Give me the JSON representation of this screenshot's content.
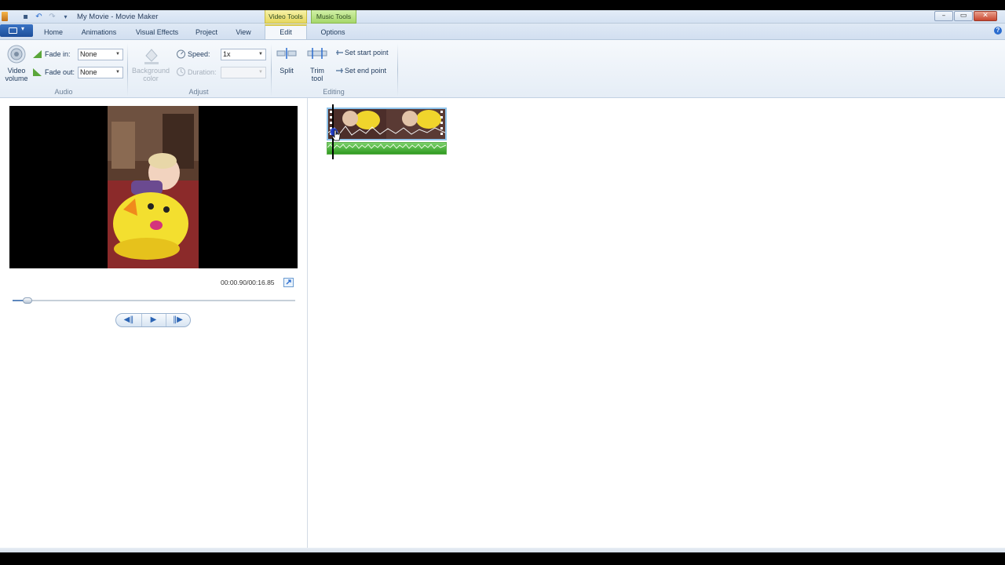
{
  "window": {
    "title": "My Movie - Movie Maker",
    "context_groups": {
      "video_tools": "Video Tools",
      "music_tools": "Music Tools"
    },
    "controls": {
      "minimize": "–",
      "maximize": "▭",
      "close": "✕"
    }
  },
  "tabs": [
    {
      "label": "Home"
    },
    {
      "label": "Animations"
    },
    {
      "label": "Visual Effects"
    },
    {
      "label": "Project"
    },
    {
      "label": "View"
    },
    {
      "label": "Edit"
    },
    {
      "label": "Options"
    }
  ],
  "ribbon": {
    "audio": {
      "group_label": "Audio",
      "video_volume": "Video volume",
      "fade_in_label": "Fade in:",
      "fade_in_value": "None",
      "fade_out_label": "Fade out:",
      "fade_out_value": "None"
    },
    "adjust": {
      "group_label": "Adjust",
      "background_color": "Background color",
      "speed_label": "Speed:",
      "speed_value": "1x",
      "duration_label": "Duration:",
      "duration_value": ""
    },
    "editing": {
      "group_label": "Editing",
      "split": "Split",
      "trim_tool": "Trim tool",
      "set_start_point": "Set start point",
      "set_end_point": "Set end point"
    }
  },
  "preview": {
    "timecode": "00:00.90/00:16.85",
    "seek_progress": 0.053,
    "controls": {
      "previous_frame": "◀‖",
      "play": "▶",
      "next_frame": "‖▶"
    }
  },
  "colors": {
    "ribbon_bg": "#e5edf6",
    "accent_blue": "#2b64b4",
    "video_tools_tab": "#e6d85e",
    "music_tools_tab": "#a6d86a",
    "audio_waveform": "#2f9a20"
  }
}
